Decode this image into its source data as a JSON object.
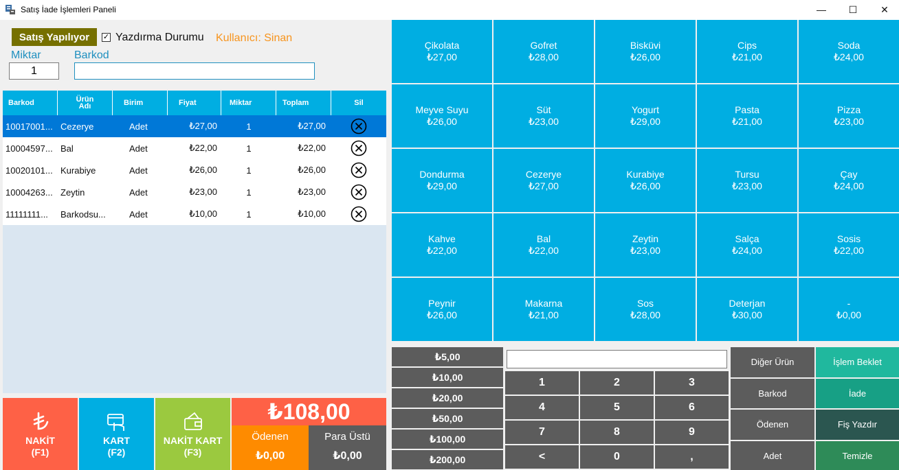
{
  "window": {
    "title": "Satış İade İşlemleri Paneli",
    "minimize_glyph": "—",
    "maximize_glyph": "☐",
    "close_glyph": "✕"
  },
  "left": {
    "status_badge": "Satış Yapılıyor",
    "print_checkbox": {
      "label": "Yazdırma Durumu",
      "checked": true,
      "glyph": "✓"
    },
    "user_label": "Kullanıcı: Sinan",
    "qty_label": "Miktar",
    "qty_value": "1",
    "barcode_label": "Barkod",
    "barcode_value": ""
  },
  "grid": {
    "headers": {
      "barcode": "Barkod",
      "name_line1": "Ürün",
      "name_line2": "Adı",
      "unit": "Birim",
      "price": "Fiyat",
      "qty": "Miktar",
      "total": "Toplam",
      "delete": "Sil"
    },
    "rows": [
      {
        "barcode": "10017001...",
        "name": "Cezerye",
        "unit": "Adet",
        "price": "₺27,00",
        "qty": "1",
        "total": "₺27,00",
        "selected": true
      },
      {
        "barcode": "10004597...",
        "name": "Bal",
        "unit": "Adet",
        "price": "₺22,00",
        "qty": "1",
        "total": "₺22,00",
        "selected": false
      },
      {
        "barcode": "10020101...",
        "name": "Kurabiye",
        "unit": "Adet",
        "price": "₺26,00",
        "qty": "1",
        "total": "₺26,00",
        "selected": false
      },
      {
        "barcode": "10004263...",
        "name": "Zeytin",
        "unit": "Adet",
        "price": "₺23,00",
        "qty": "1",
        "total": "₺23,00",
        "selected": false
      },
      {
        "barcode": "11111111...",
        "name": "Barkodsu...",
        "unit": "Adet",
        "price": "₺10,00",
        "qty": "1",
        "total": "₺10,00",
        "selected": false
      }
    ],
    "delete_icon": "circle-x-icon"
  },
  "payment": {
    "cash": {
      "line1": "NAKİT",
      "line2": "(F1)",
      "icon": "lira-icon"
    },
    "card": {
      "line1": "KART",
      "line2": "(F2)",
      "icon": "card-icon"
    },
    "mixed": {
      "line1": "NAKİT KART",
      "line2": "(F3)",
      "icon": "wallet-icon"
    },
    "total": "₺108,00",
    "paid_label": "Ödenen",
    "paid_value": "₺0,00",
    "change_label": "Para Üstü",
    "change_value": "₺0,00"
  },
  "products": [
    {
      "name": "Çikolata",
      "price": "₺27,00"
    },
    {
      "name": "Gofret",
      "price": "₺28,00"
    },
    {
      "name": "Bisküvi",
      "price": "₺26,00"
    },
    {
      "name": "Cips",
      "price": "₺21,00"
    },
    {
      "name": "Soda",
      "price": "₺24,00"
    },
    {
      "name": "Meyve Suyu",
      "price": "₺26,00"
    },
    {
      "name": "Süt",
      "price": "₺23,00"
    },
    {
      "name": "Yogurt",
      "price": "₺29,00"
    },
    {
      "name": "Pasta",
      "price": "₺21,00"
    },
    {
      "name": "Pizza",
      "price": "₺23,00"
    },
    {
      "name": "Dondurma",
      "price": "₺29,00"
    },
    {
      "name": "Cezerye",
      "price": "₺27,00"
    },
    {
      "name": "Kurabiye",
      "price": "₺26,00"
    },
    {
      "name": "Tursu",
      "price": "₺23,00"
    },
    {
      "name": "Çay",
      "price": "₺24,00"
    },
    {
      "name": "Kahve",
      "price": "₺22,00"
    },
    {
      "name": "Bal",
      "price": "₺22,00"
    },
    {
      "name": "Zeytin",
      "price": "₺23,00"
    },
    {
      "name": "Salça",
      "price": "₺24,00"
    },
    {
      "name": "Sosis",
      "price": "₺22,00"
    },
    {
      "name": "Peynir",
      "price": "₺26,00"
    },
    {
      "name": "Makarna",
      "price": "₺21,00"
    },
    {
      "name": "Sos",
      "price": "₺28,00"
    },
    {
      "name": "Deterjan",
      "price": "₺30,00"
    },
    {
      "name": "-",
      "price": "₺0,00"
    }
  ],
  "cash_buttons": [
    "₺5,00",
    "₺10,00",
    "₺20,00",
    "₺50,00",
    "₺100,00",
    "₺200,00"
  ],
  "numpad": {
    "display": "",
    "keys": [
      "1",
      "2",
      "3",
      "4",
      "5",
      "6",
      "7",
      "8",
      "9",
      "<",
      "0",
      ","
    ]
  },
  "functions": {
    "other_product": "Diğer Ürün",
    "hold": "İşlem Beklet",
    "barcode": "Barkod",
    "refund": "İade",
    "paid": "Ödenen",
    "print_receipt": "Fiş Yazdır",
    "qty": "Adet",
    "clear": "Temizle"
  },
  "colors": {
    "accent_blue": "#00aee2",
    "selected_row": "#0078d7",
    "cash_red": "#fe6146",
    "mixed_green": "#9bc93f",
    "paid_orange": "#fe8b00",
    "dark_gray": "#5c5c5c",
    "badge_olive": "#767000",
    "user_orange": "#f7941d"
  }
}
